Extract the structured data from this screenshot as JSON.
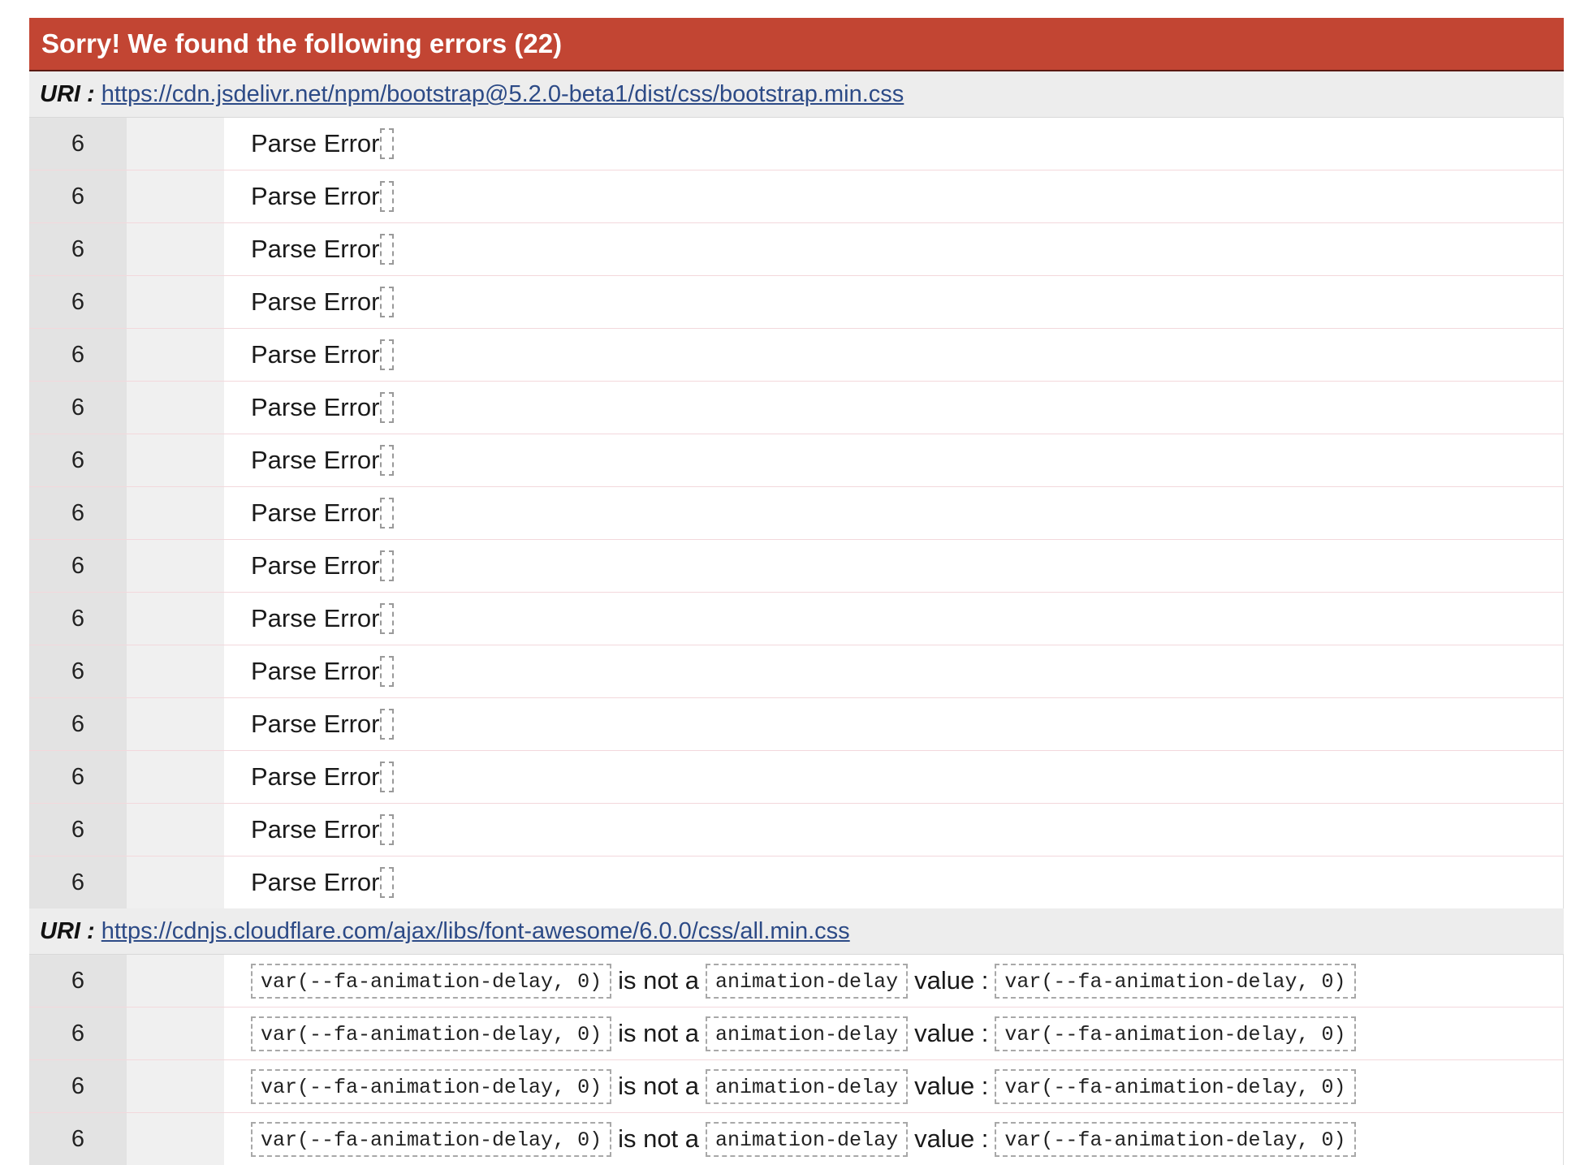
{
  "header": {
    "title": "Sorry! We found the following errors (22)"
  },
  "uri_label": "URI :",
  "groups": [
    {
      "uri": "https://cdn.jsdelivr.net/npm/bootstrap@5.2.0-beta1/dist/css/bootstrap.min.css",
      "rows": [
        {
          "line": "6",
          "message": "Parse Error"
        },
        {
          "line": "6",
          "message": "Parse Error"
        },
        {
          "line": "6",
          "message": "Parse Error"
        },
        {
          "line": "6",
          "message": "Parse Error"
        },
        {
          "line": "6",
          "message": "Parse Error"
        },
        {
          "line": "6",
          "message": "Parse Error"
        },
        {
          "line": "6",
          "message": "Parse Error"
        },
        {
          "line": "6",
          "message": "Parse Error"
        },
        {
          "line": "6",
          "message": "Parse Error"
        },
        {
          "line": "6",
          "message": "Parse Error"
        },
        {
          "line": "6",
          "message": "Parse Error"
        },
        {
          "line": "6",
          "message": "Parse Error"
        },
        {
          "line": "6",
          "message": "Parse Error"
        },
        {
          "line": "6",
          "message": "Parse Error"
        },
        {
          "line": "6",
          "message": "Parse Error"
        }
      ]
    },
    {
      "uri": "https://cdnjs.cloudflare.com/ajax/libs/font-awesome/6.0.0/css/all.min.css",
      "rows": [
        {
          "line": "6",
          "value": "var(--fa-animation-delay, 0)",
          "is_not_a": "is not a",
          "property": "animation-delay",
          "value_label": "value :",
          "value_repeat": "var(--fa-animation-delay, 0)"
        },
        {
          "line": "6",
          "value": "var(--fa-animation-delay, 0)",
          "is_not_a": "is not a",
          "property": "animation-delay",
          "value_label": "value :",
          "value_repeat": "var(--fa-animation-delay, 0)"
        },
        {
          "line": "6",
          "value": "var(--fa-animation-delay, 0)",
          "is_not_a": "is not a",
          "property": "animation-delay",
          "value_label": "value :",
          "value_repeat": "var(--fa-animation-delay, 0)"
        },
        {
          "line": "6",
          "value": "var(--fa-animation-delay, 0)",
          "is_not_a": "is not a",
          "property": "animation-delay",
          "value_label": "value :",
          "value_repeat": "var(--fa-animation-delay, 0)"
        }
      ]
    }
  ]
}
